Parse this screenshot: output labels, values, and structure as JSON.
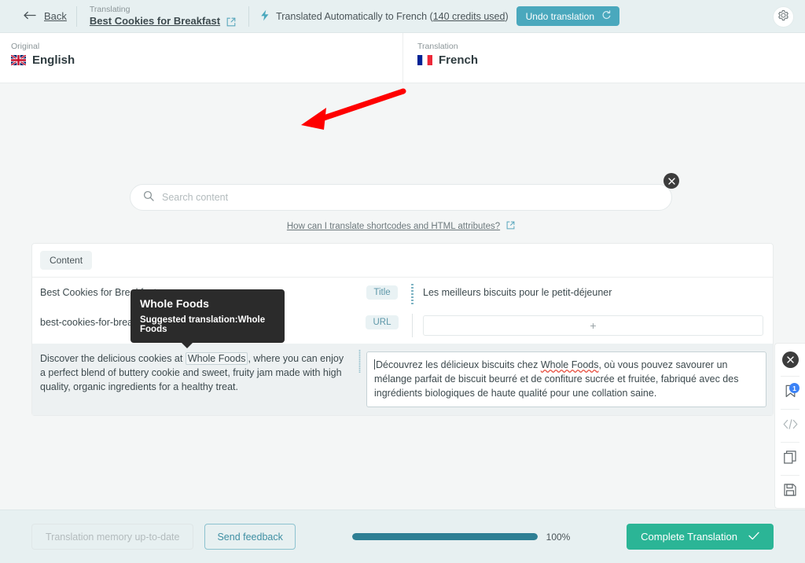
{
  "topbar": {
    "back_label": "Back",
    "translating_label": "Translating",
    "document_title": "Best Cookies for Breakfast",
    "auto_note_prefix": "Translated Automatically to French (",
    "credits_used": "140 credits used",
    "auto_note_suffix": ")",
    "undo_label": "Undo translation",
    "accent": "#4aa8bd"
  },
  "langbar": {
    "original_label": "Original",
    "original_language": "English",
    "translation_label": "Translation",
    "translation_language": "French"
  },
  "search": {
    "placeholder": "Search content",
    "value": "",
    "help_text": "How can I translate shortcodes and HTML attributes?"
  },
  "card": {
    "tab_label": "Content",
    "rows": [
      {
        "source": "Best Cookies for Breakfast",
        "badge": "Title",
        "target": "Les meilleurs biscuits pour le petit-déjeuner"
      },
      {
        "source": "best-cookies-for-breakfast",
        "badge": "URL",
        "target": "+"
      }
    ],
    "body_row": {
      "source_part1": "Discover the delicious cookies at ",
      "source_term": "Whole Foods",
      "source_part2": ", where you can enjoy a perfect blend of buttery cookie and sweet, fruity jam made with high quality, organic ingredients for a healthy treat.",
      "target_part1": "Découvrez les délicieux biscuits chez ",
      "target_term": "Whole Foods",
      "target_part2": ", où vous pouvez savourer un mélange parfait de biscuit beurré et de confiture sucrée et fruitée, fabriqué avec des ingrédients biologiques de haute qualité pour une collation saine."
    }
  },
  "tooltip": {
    "title": "Whole Foods",
    "subtitle": "Suggested translation:Whole Foods"
  },
  "rail": {
    "bookmark_count": "1",
    "badge_color": "#3b82f6"
  },
  "annotation": {
    "arrow_color": "#fe0000"
  },
  "footer": {
    "memory_label": "Translation memory up-to-date",
    "feedback_label": "Send feedback",
    "progress_pct_label": "100%",
    "progress_value": 100,
    "complete_label": "Complete Translation",
    "complete_color": "#2bb596"
  }
}
